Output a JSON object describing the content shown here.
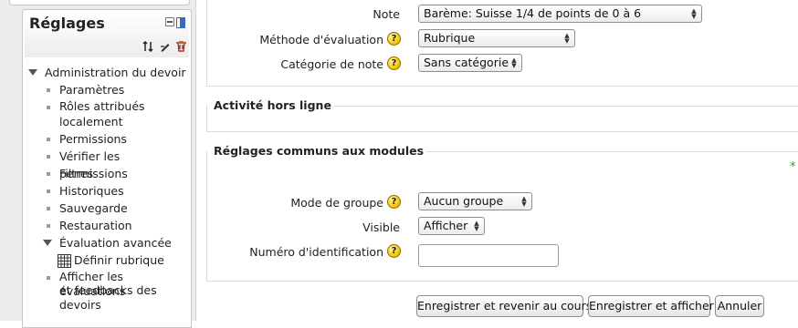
{
  "settings_block": {
    "title": "Réglages",
    "icons": [
      "dock-icon",
      "move-icon",
      "edit-icon",
      "delete-icon"
    ],
    "tree": {
      "parent_label": "Administration du devoir",
      "items": [
        {
          "label": "Paramètres"
        },
        {
          "label": "Rôles attribués"
        },
        {
          "label": "localement"
        },
        {
          "label": "Permissions"
        },
        {
          "label": "Vérifier les permissions"
        },
        {
          "label": "Filtres"
        },
        {
          "label": "Historiques"
        },
        {
          "label": "Sauvegarde"
        },
        {
          "label": "Restauration"
        }
      ],
      "advanced_label": "Évaluation avancée",
      "define_rubric_label": "Définir rubrique",
      "feedback_lines": [
        "Afficher les évaluations",
        "et feedbacks des",
        "devoirs"
      ]
    }
  },
  "grade": {
    "note_label": "Note",
    "note_value": "Barème: Suisse 1/4 de points de 0 à 6",
    "method_label": "Méthode d'évaluation",
    "method_value": "Rubrique",
    "category_label": "Catégorie de note",
    "category_value": "Sans catégorie"
  },
  "offline_section": {
    "legend": "Activité hors ligne"
  },
  "common_section": {
    "legend": "Réglages communs aux modules",
    "required_marker": "*",
    "group_mode_label": "Mode de groupe",
    "group_mode_value": "Aucun groupe",
    "visible_label": "Visible",
    "visible_value": "Afficher",
    "idnumber_label": "Numéro d'identification",
    "idnumber_value": ""
  },
  "buttons": {
    "save_return": "Enregistrer et revenir au cours",
    "save_display": "Enregistrer et afficher",
    "cancel": "Annuler"
  },
  "help_icon_glyph": "?",
  "colors": {
    "required_marker": "#2e9b2e",
    "help_icon": "#f2c200"
  }
}
